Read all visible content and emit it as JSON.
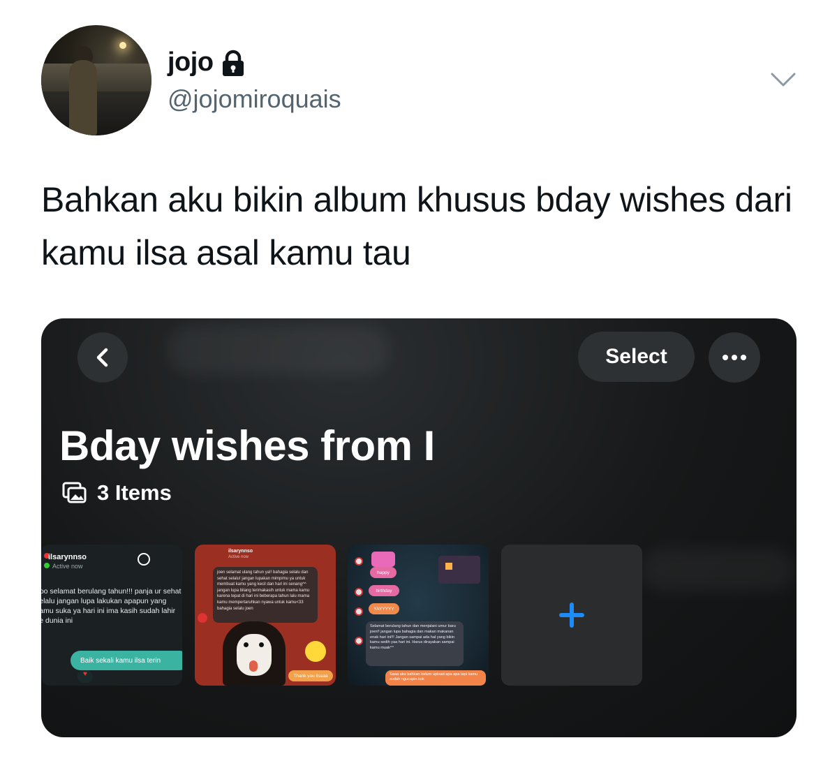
{
  "tweet": {
    "display_name": "jojo",
    "handle": "@jojomiroquais",
    "text": "Bahkan aku bikin album khusus bday wishes dari kamu ilsa asal kamu tau"
  },
  "album_screen": {
    "select_label": "Select",
    "title": "Bday wishes from I",
    "items_count": "3 Items",
    "thumbnails": [
      {
        "username": "ilsarynnso",
        "status": "Active now",
        "message": "ooo selamat berulang tahun!!! panja ur sehat selalu jangan lupa lakukan apapun yang kamu suka ya hari ini ima kasih sudah lahir ke dunia ini",
        "reply": "Baik sekali kamu ilsa terin"
      },
      {
        "username": "ilsarynnso",
        "status": "Active now",
        "message": "joen selamat ulang tahun ya!! bahagia selalu dan sehat selalu! jangan lupakan mimpimu ya untuk membuat kamu yang kecil dan hari ini senang^^ jangan lupa bilang terimakasih untuk mama kamu karena tepat di hari ini beberapa tahun lalu mama kamu mempertaruhkan nyawa untuk kamu<33 bahagia selalu joen",
        "reply": "Thank you ilsaaa"
      },
      {
        "bubbles": [
          "happy",
          "birthday",
          "YAYYYYY"
        ],
        "message": "Selamat berulang tahun dan menjalani umur baru joen!! jangan lupa bahagia dan makan makanan enak hari ini!!! Jangan sampai ada hal yang bikin kamu sedih yaa hari ini. Harus dirayakan sampai kamu muak^^",
        "reply": "Saaa aku bahkan belum upload apa apa tapi kamu sudah ngucapin kok"
      }
    ]
  },
  "colors": {
    "handle_gray": "#536471",
    "album_bg": "#161819",
    "button_bg": "#2e3133",
    "add_blue": "#1d8cf8",
    "reply_teal": "#3bb3a3"
  },
  "icons": [
    "lock-icon",
    "chevron-down-icon",
    "chevron-left-icon",
    "more-horizontal-icon",
    "photo-stack-icon",
    "plus-icon"
  ]
}
